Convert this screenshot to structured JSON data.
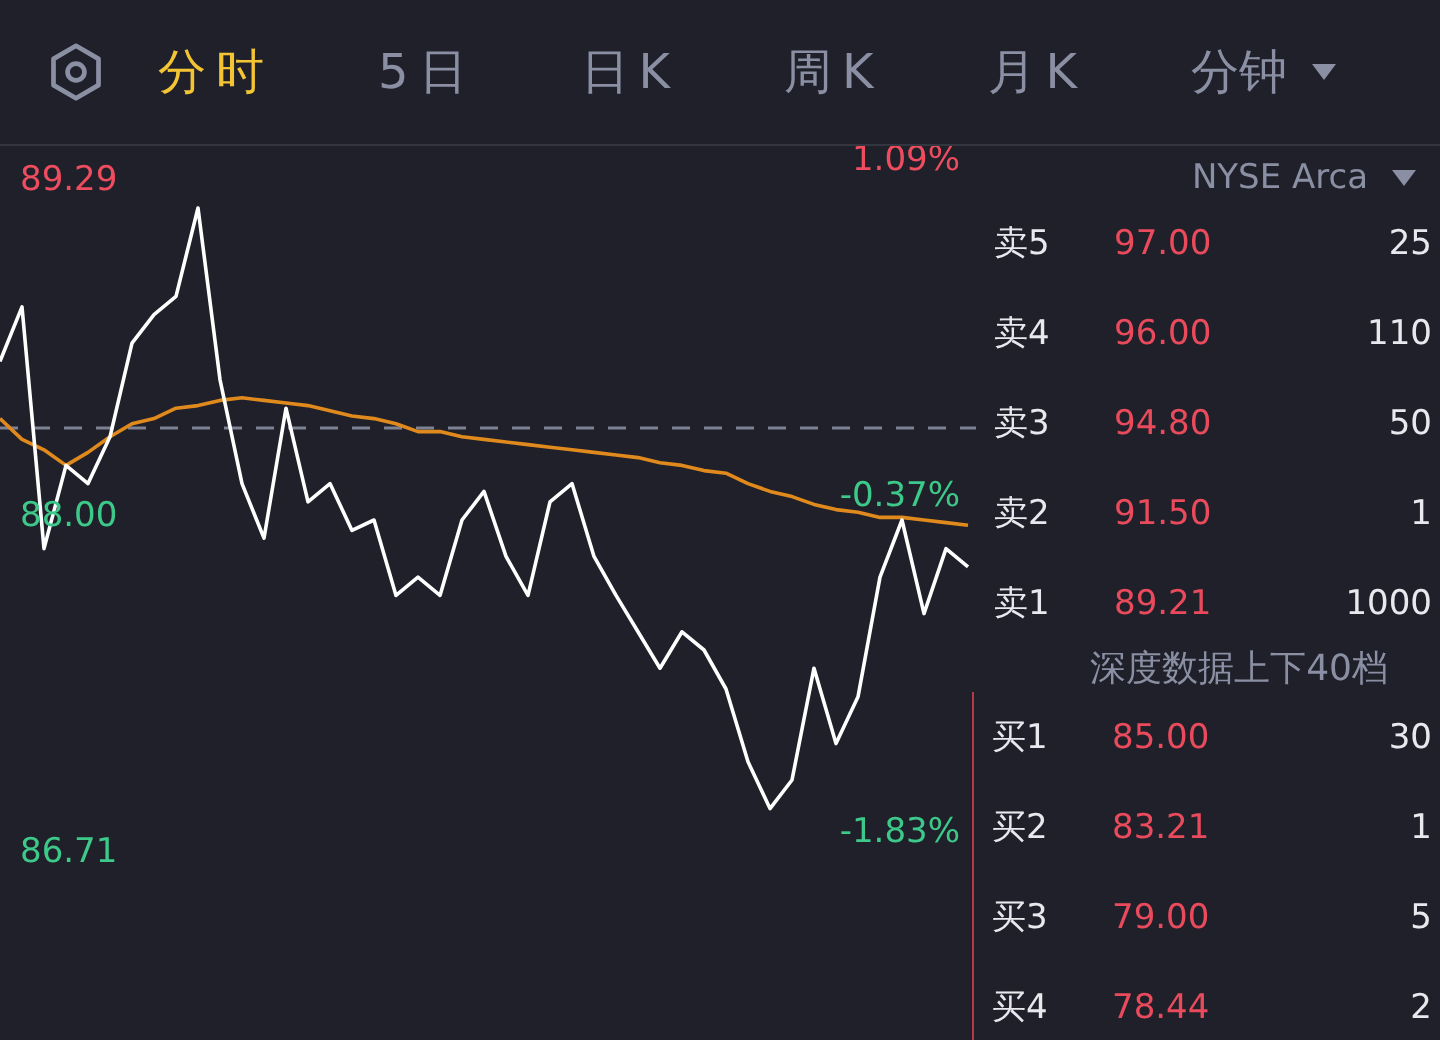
{
  "tabs": [
    {
      "label": "分时",
      "selected": true
    },
    {
      "label": "5日",
      "selected": false
    },
    {
      "label": "日K",
      "selected": false
    },
    {
      "label": "周K",
      "selected": false
    },
    {
      "label": "月K",
      "selected": false
    }
  ],
  "interval_dropdown": {
    "label": "分钟"
  },
  "chart": {
    "chart_data": {
      "type": "line",
      "ylim": [
        86.0,
        90.0
      ],
      "yticks": [
        {
          "value": 89.29,
          "label": "89.29"
        },
        {
          "value": 88.0,
          "label": "88.00"
        },
        {
          "value": 86.71,
          "label": "86.71"
        }
      ],
      "series": [
        {
          "color": "#ffffff",
          "values": [
            88.61,
            88.82,
            87.89,
            88.21,
            88.14,
            88.32,
            88.68,
            88.79,
            88.86,
            89.2,
            88.54,
            88.14,
            87.93,
            88.43,
            88.07,
            88.14,
            87.96,
            88.0,
            87.71,
            87.78,
            87.71,
            88.0,
            88.11,
            87.86,
            87.71,
            88.07,
            88.14,
            87.86,
            87.71,
            87.57,
            87.43,
            87.57,
            87.5,
            87.35,
            87.07,
            86.89,
            87.0,
            87.43,
            87.14,
            87.32,
            87.78,
            88.0,
            87.64,
            87.89,
            87.82
          ]
        },
        {
          "color": "#e08a1e",
          "values": [
            88.39,
            88.31,
            88.27,
            88.21,
            88.26,
            88.32,
            88.37,
            88.39,
            88.43,
            88.44,
            88.46,
            88.47,
            88.46,
            88.45,
            88.44,
            88.42,
            88.4,
            88.39,
            88.37,
            88.34,
            88.34,
            88.32,
            88.31,
            88.3,
            88.29,
            88.28,
            88.27,
            88.26,
            88.25,
            88.24,
            88.22,
            88.21,
            88.19,
            88.18,
            88.14,
            88.11,
            88.09,
            88.06,
            88.04,
            88.03,
            88.01,
            88.01,
            88.0,
            87.99,
            87.98
          ]
        }
      ]
    },
    "change_labels": [
      "1.09%",
      "-0.37%",
      "-1.83%"
    ]
  },
  "order_book": {
    "exchange": "NYSE Arca",
    "asks": [
      {
        "label": "卖5",
        "price": "97.00",
        "volume": "25"
      },
      {
        "label": "卖4",
        "price": "96.00",
        "volume": "110"
      },
      {
        "label": "卖3",
        "price": "94.80",
        "volume": "50"
      },
      {
        "label": "卖2",
        "price": "91.50",
        "volume": "1"
      },
      {
        "label": "卖1",
        "price": "89.21",
        "volume": "1000"
      }
    ],
    "depth_note": "深度数据上下40档",
    "bids": [
      {
        "label": "买1",
        "price": "85.00",
        "volume": "30"
      },
      {
        "label": "买2",
        "price": "83.21",
        "volume": "1"
      },
      {
        "label": "买3",
        "price": "79.00",
        "volume": "5"
      },
      {
        "label": "买4",
        "price": "78.44",
        "volume": "2"
      }
    ]
  }
}
